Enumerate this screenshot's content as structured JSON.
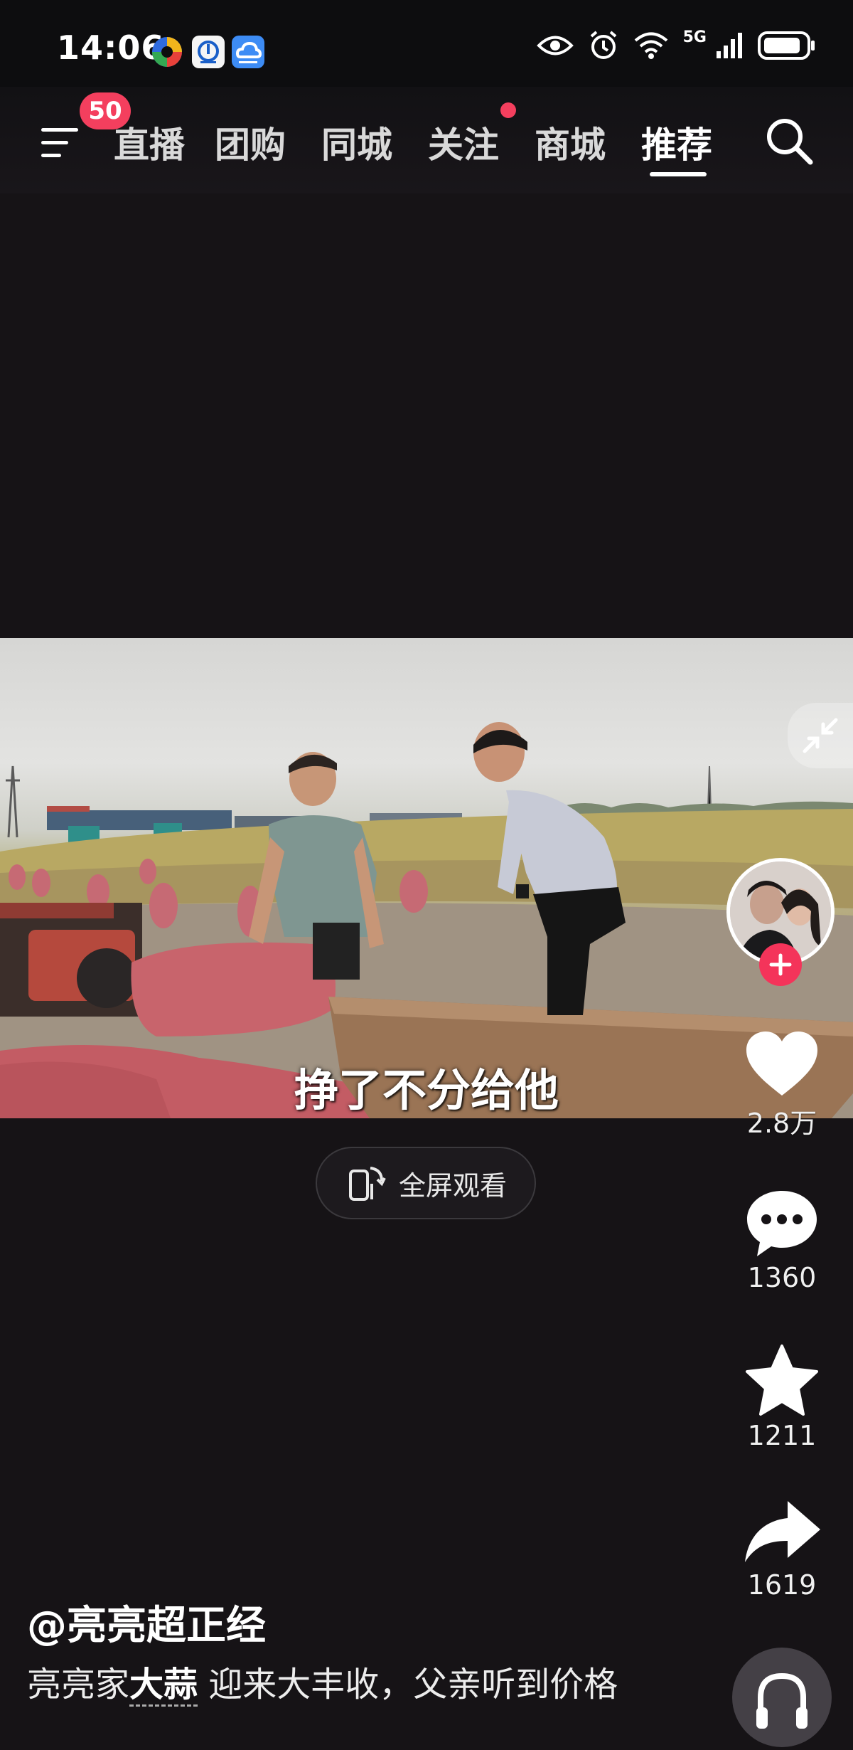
{
  "status_bar": {
    "time": "14:06",
    "network": "5G",
    "app_icons": [
      "colorful-app-icon",
      "blue-app-icon",
      "cloud-app-icon"
    ],
    "right_icons": [
      "eye-icon",
      "alarm-icon",
      "wifi-icon",
      "signal-icon",
      "battery-icon"
    ]
  },
  "top_nav": {
    "menu_badge": "50",
    "tabs": [
      {
        "label": "直播",
        "active": false
      },
      {
        "label": "团购",
        "active": false
      },
      {
        "label": "同城",
        "active": false
      },
      {
        "label": "关注",
        "active": false,
        "dot": true
      },
      {
        "label": "商城",
        "active": false
      },
      {
        "label": "推荐",
        "active": true
      }
    ]
  },
  "video": {
    "caption": "挣了不分给他"
  },
  "fullscreen": {
    "label": "全屏观看"
  },
  "actions": {
    "like_count": "2.8万",
    "comment_count": "1360",
    "favorite_count": "1211",
    "share_count": "1619"
  },
  "post": {
    "author": "@亮亮超正经",
    "desc_prefix": "亮亮家",
    "desc_keyword": "大蒜",
    "desc_suffix": " 迎来大丰收，父亲听到价格"
  },
  "colors": {
    "accent": "#f43f5e",
    "background": "#161316",
    "status_bar": "#0d0d0f"
  }
}
